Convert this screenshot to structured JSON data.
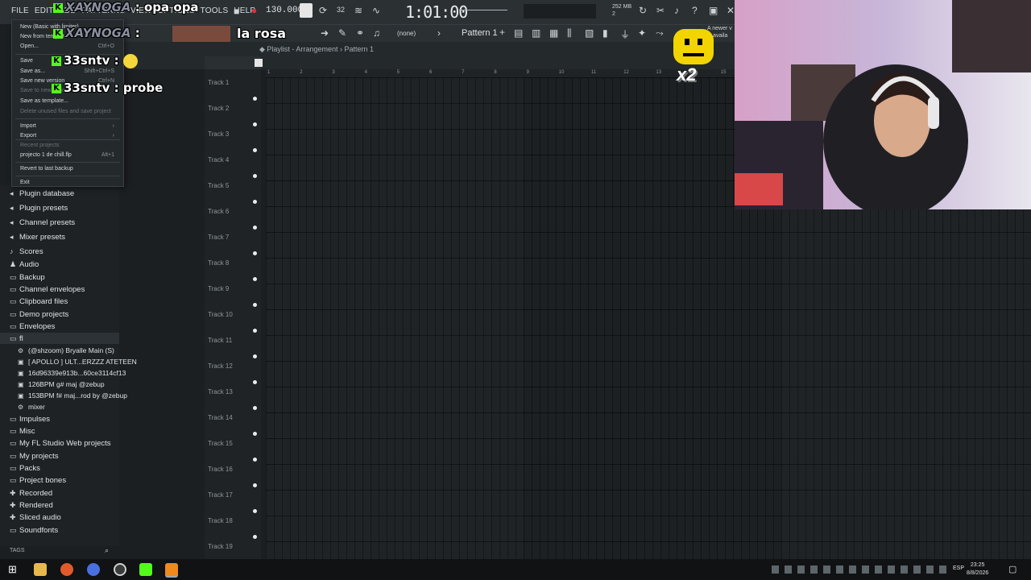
{
  "menubar": [
    "FILE",
    "EDIT",
    "ADD",
    "PATTERNS",
    "VIEW",
    "OPTIONS",
    "TOOLS",
    "HELP"
  ],
  "tempo": "130.000",
  "time": "1:01:00",
  "mem_top": "252 MB",
  "mem_bottom": "2",
  "pattern": "Pattern 1",
  "none_label": "(none)",
  "notice": "A newer v is availa",
  "chat": [
    {
      "user": "XAYNOGA",
      "message": "opa opa"
    },
    {
      "user": "XAYNOGA",
      "message": "la rosa"
    },
    {
      "user": "33sntv",
      "message": ""
    },
    {
      "user": "33sntv",
      "message": "probe"
    }
  ],
  "emote_label": "x2",
  "file_menu": [
    {
      "label": "New (Basic with limiter)",
      "shortcut": ""
    },
    {
      "label": "New from template",
      "shortcut": ""
    },
    {
      "label": "Open...",
      "shortcut": "Ctrl+O"
    },
    {
      "label": "Save",
      "shortcut": ""
    },
    {
      "label": "Save as...",
      "shortcut": "Shift+Ctrl+S"
    },
    {
      "label": "Save new version",
      "shortcut": "Ctrl+N"
    },
    {
      "label": "Save to new project...",
      "shortcut": ""
    },
    {
      "label": "Save as template...",
      "shortcut": ""
    },
    {
      "label": "Delete unused files and save project",
      "shortcut": ""
    },
    {
      "label": "Import",
      "shortcut": "›"
    },
    {
      "label": "Export",
      "shortcut": "›"
    },
    {
      "label": "Recent projects",
      "shortcut": ""
    },
    {
      "label": "projecto 1 de chill.flp",
      "shortcut": "Alt+1"
    },
    {
      "label": "Revert to last backup",
      "shortcut": ""
    },
    {
      "label": "Exit",
      "shortcut": ""
    }
  ],
  "browser": [
    {
      "label": "Plugin database",
      "icon": "plug-icon"
    },
    {
      "label": "Plugin presets",
      "icon": "plug-icon"
    },
    {
      "label": "Channel presets",
      "icon": "plug-icon"
    },
    {
      "label": "Mixer presets",
      "icon": "plug-icon"
    },
    {
      "label": "Scores",
      "icon": "note-icon"
    },
    {
      "label": "Audio",
      "icon": "person-icon"
    },
    {
      "label": "Backup",
      "icon": "folder-icon"
    },
    {
      "label": "Channel envelopes",
      "icon": "folder-icon"
    },
    {
      "label": "Clipboard files",
      "icon": "folder-icon"
    },
    {
      "label": "Demo projects",
      "icon": "folder-icon"
    },
    {
      "label": "Envelopes",
      "icon": "folder-icon"
    },
    {
      "label": "fl",
      "icon": "folder-icon"
    }
  ],
  "browser_sub": [
    {
      "label": "(@shzoom) Bryalle Main (S)",
      "icon": "gear-icon"
    },
    {
      "label": "[ APOLLO ] ULT...ERZZZ ATETEEN",
      "icon": "wave-icon"
    },
    {
      "label": "16d96339e913b...60ce3114cf13",
      "icon": "wave-icon"
    },
    {
      "label": "126BPM g# maj @zebup",
      "icon": "wave-icon"
    },
    {
      "label": "153BPM f# maj...rod by @zebup",
      "icon": "wave-icon"
    },
    {
      "label": "mixer",
      "icon": "gear-icon"
    }
  ],
  "browser_bottom": [
    {
      "label": "Impulses",
      "icon": "folder-icon"
    },
    {
      "label": "Misc",
      "icon": "folder-icon"
    },
    {
      "label": "My FL Studio Web projects",
      "icon": "folder-icon"
    },
    {
      "label": "My projects",
      "icon": "folder-icon"
    },
    {
      "label": "Packs",
      "icon": "folder-icon"
    },
    {
      "label": "Project bones",
      "icon": "folder-icon"
    },
    {
      "label": "Recorded",
      "icon": "plus-icon"
    },
    {
      "label": "Rendered",
      "icon": "plus-icon"
    },
    {
      "label": "Sliced audio",
      "icon": "plus-icon"
    },
    {
      "label": "Soundfonts",
      "icon": "folder-icon"
    }
  ],
  "tags_label": "TAGS",
  "playlist_title": "Playlist - Arrangement",
  "playlist_pattern": "Pattern 1",
  "tracks": [
    "Track 1",
    "Track 2",
    "Track 3",
    "Track 4",
    "Track 5",
    "Track 6",
    "Track 7",
    "Track 8",
    "Track 9",
    "Track 10",
    "Track 11",
    "Track 12",
    "Track 13",
    "Track 14",
    "Track 15",
    "Track 16",
    "Track 17",
    "Track 18",
    "Track 19"
  ],
  "ruler": [
    "1",
    "2",
    "3",
    "4",
    "5",
    "6",
    "7",
    "8",
    "9",
    "10",
    "11",
    "12",
    "13",
    "14",
    "15"
  ],
  "clock_time": "23:25",
  "clock_date": "8/8/2026",
  "lang": "ESP",
  "colors": {
    "kick_green": "#53fc18",
    "accent": "#e8ecee",
    "toolbar": "#2b3033"
  }
}
